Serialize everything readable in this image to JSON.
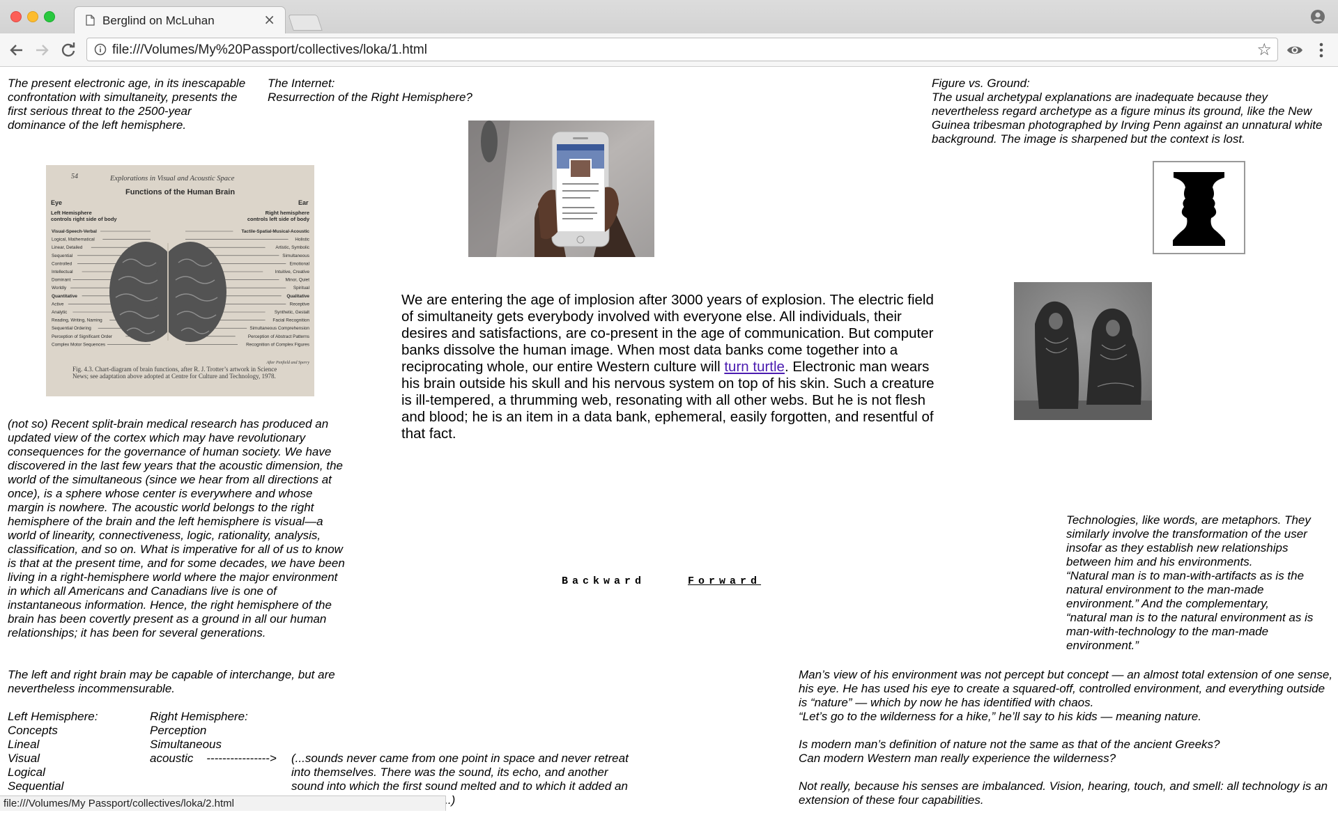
{
  "browser": {
    "tab_title": "Berglind on McLuhan",
    "tab_close": "×",
    "url": "file:///Volumes/My%20Passport/collectives/loka/1.html",
    "star": "☆",
    "status_url": "file:///Volumes/My Passport/collectives/loka/2.html"
  },
  "page": {
    "top_left": "The present electronic age, in its inescapable confrontation with simultaneity, presents the first serious threat to the 2500-year dominance of the left hemisphere.",
    "internet_title": "The Internet:",
    "internet_subtitle": "Resurrection of the Right Hemisphere?",
    "figure_title": "Figure vs. Ground:",
    "figure_body": "The usual archetypal explanations are inadequate because they nevertheless regard archetype as a figure minus its ground, like the New Guinea tribesman photographed by Irving Penn against an unnatural white background. The image is sharpened but the context is lost.",
    "main_text_1": "We are entering the age of implosion after 3000 years of explosion. The electric field of simultaneity gets everybody involved with everyone else. All individuals, their desires and satisfactions, are co-present in the age of communication. But computer banks dissolve the human image. When most data banks come together into a reciprocating whole, our entire Western culture will ",
    "main_link": "turn turtle",
    "main_text_2": ". Electronic man wears his brain outside his skull and his nervous system on top of his skin. Such a creature is ill-tempered, a thrumming web, resonating with all other webs. But he is not flesh and blood; he is an item in a data bank, ephemeral, easily forgotten, and resentful of that fact.",
    "split_brain": "(not so) Recent split-brain medical research has produced an updated view of the cortex which may have revolutionary consequences for the governance of human society. We have discovered in the last few years that the acoustic dimension, the world of the simultaneous (since we hear from all directions at once), is a sphere whose center is everywhere and whose margin is nowhere. The acoustic world belongs to the right hemisphere of the brain and the left hemisphere is visual—a world of linearity, connectiveness, logic, rationality, analysis, classification, and so on. What is imperative for all of us to know is that at the present time, and for some decades, we have been living in a right-hemisphere world where the major environment in which all Americans and Canadians live is one of instantaneous information. Hence, the right hemisphere of the brain has been covertly present as a ground in all our human relationships; it has been for several generations.",
    "interchange": "The left and right brain may be capable of interchange, but are nevertheless incommensurable.",
    "hemispheres": [
      [
        "Left Hemisphere:",
        "Right Hemisphere:"
      ],
      [
        "Concepts",
        "Perception"
      ],
      [
        "Lineal",
        "Simultaneous"
      ],
      [
        "Visual",
        "acoustic    ---------------->"
      ],
      [
        "Logical",
        ""
      ],
      [
        "Sequential",
        ""
      ]
    ],
    "sounds": "(...sounds never came from one point in space and never retreat into themselves. There was the sound, its echo, and another sound into which the first sound melted and to which it added an endless procession of sound...)",
    "tech_1": "Technologies, like words, are metaphors. They similarly involve the transformation of the user insofar as they establish new relationships between him and his environments.",
    "tech_2": "“Natural man is to man-with-artifacts as is the natural environment to the man-made environment.” And the complementary,",
    "tech_3": "“natural man is to the natural environment as is man-with-technology to the man-made environment.”",
    "mans_1": "Man’s view of his environment was not percept but concept — an almost total extension of one sense, his eye. He has used his eye to create a squared-off, controlled environment, and everything outside is “nature” — which by now he has identified with chaos.",
    "mans_2": "“Let’s go to the wilderness for a hike,” he’ll say to his kids — meaning nature.",
    "mans_3": "Is modern man’s definition of nature not the same as that of the ancient Greeks?",
    "mans_4": "Can modern Western man really experience the wilderness?",
    "mans_5": "Not really, because his senses are imbalanced. Vision, hearing, touch, and smell: all technology is an extension of these four capabilities.",
    "nav_backward": "Backward",
    "nav_forward": "Forward"
  },
  "brain_figure": {
    "page_number": "54",
    "running_head": "Explorations in Visual and Acoustic Space",
    "title": "Functions of the Human Brain",
    "eye": "Eye",
    "ear": "Ear",
    "left_head": "Left Hemisphere",
    "left_sub": "controls right side of body",
    "right_head": "Right hemisphere",
    "right_sub": "controls left side of body",
    "left_list": [
      "Visual-Speech-Verbal",
      "Logical, Mathematical",
      "Linear, Detailed",
      "Sequential",
      "Controlled",
      "Intellectual",
      "Dominant",
      "Worldly",
      "Quantitative",
      "Active",
      "Analytic",
      "Reading, Writing, Naming",
      "Sequential Ordering",
      "Perception of Significant Order",
      "Complex Motor Sequences"
    ],
    "right_list": [
      "Tactile-Spatial-Musical-Acoustic",
      "Holistic",
      "Artistic, Symbolic",
      "Simultaneous",
      "Emotional",
      "Intuitive, Creative",
      "Minor, Quiet",
      "Spiritual",
      "Qualitative",
      "Receptive",
      "Synthetic, Gestalt",
      "Facial Recognition",
      "Simultaneous Comprehension",
      "Perception of Abstract Patterns",
      "Recognition of Complex Figures"
    ],
    "credit": "After Penfield and Sperry",
    "caption": "Fig. 4.3. Chart-diagram of brain functions, after R. J. Trotter’s artwork in Science News; see adaptation above adopted at Centre for Culture and Technology, 1978."
  },
  "icons": {
    "tab_favicon": "document-icon",
    "back": "arrow-left-icon",
    "forward": "arrow-right-icon",
    "reload": "reload-icon",
    "info": "info-icon",
    "bookmark": "star-icon",
    "extension": "eye-icon",
    "menu": "kebab-menu-icon",
    "profile": "profile-icon"
  },
  "colors": {
    "link_visited": "#4a1bb0",
    "traffic_red": "#fc5f57",
    "traffic_yellow": "#fdbc2e",
    "traffic_green": "#29c83f"
  }
}
